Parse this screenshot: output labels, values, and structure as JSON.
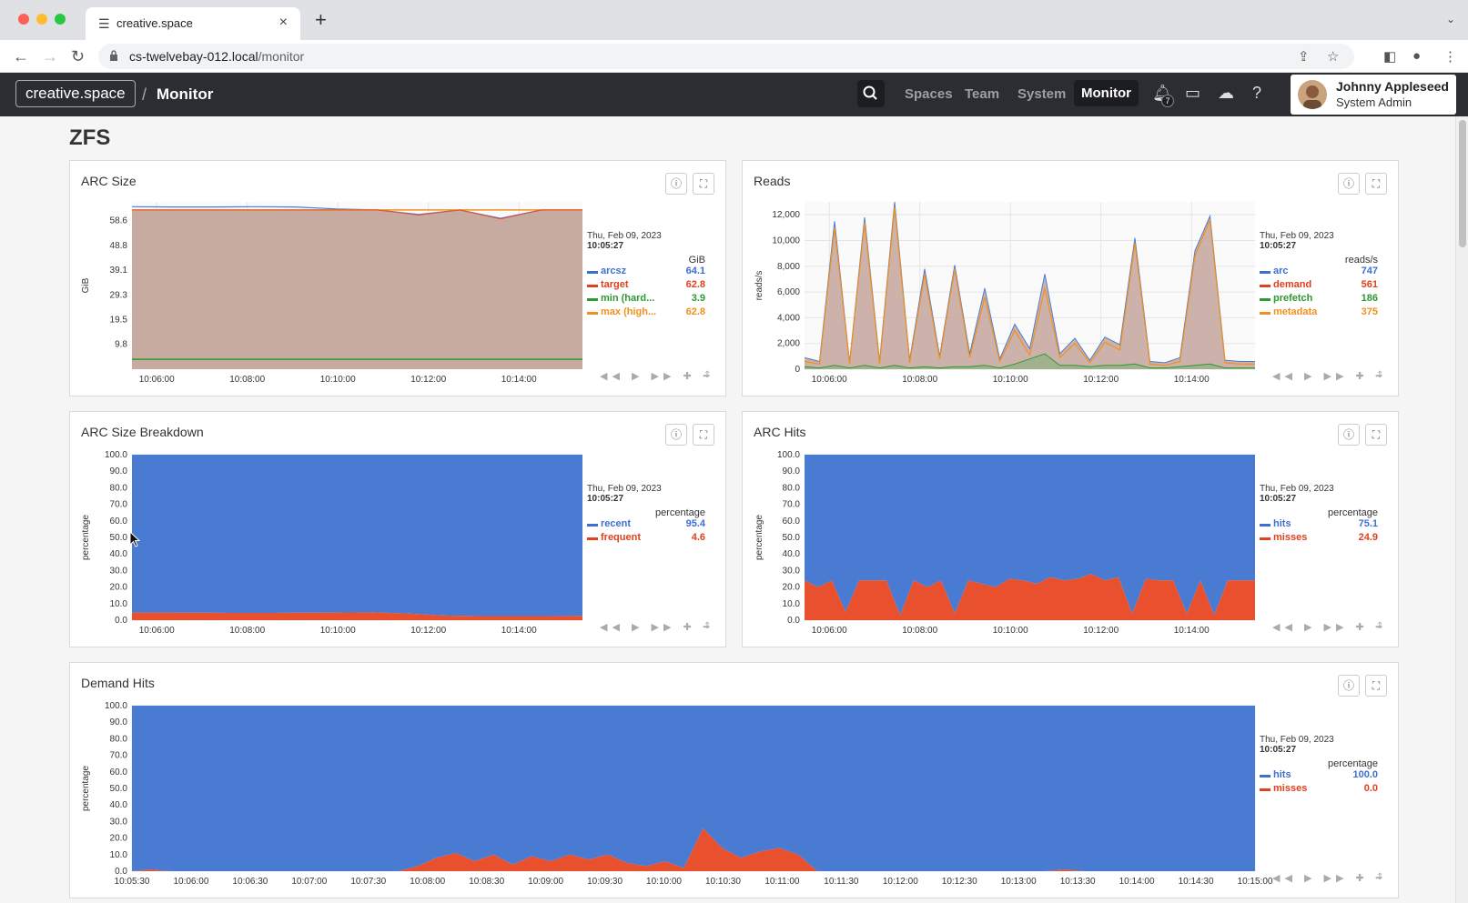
{
  "browser": {
    "tab_title": "creative.space",
    "url_host": "cs-twelvebay-012.local",
    "url_path": "/monitor"
  },
  "app": {
    "brand": "creative.space",
    "breadcrumb": "Monitor",
    "nav": [
      "Spaces",
      "Team",
      "System",
      "Monitor"
    ],
    "active_nav": "Monitor",
    "notification_count": "7",
    "user_name": "Johnny Appleseed",
    "user_role": "System Admin"
  },
  "section_title": "ZFS",
  "colors": {
    "blue": "#4a7bd3",
    "red": "#e8502e",
    "green": "#2b9a2f",
    "orange": "#f0901e",
    "arc_fill": "#c4a69c"
  },
  "panels": {
    "arc_size": {
      "title": "ARC Size",
      "legend_date": "Thu, Feb 09, 2023",
      "legend_time": "10:05:27",
      "unit": "GiB",
      "rows": [
        {
          "name": "arcsz",
          "value": "64.1",
          "color": "#3d6fd0"
        },
        {
          "name": "target",
          "value": "62.8",
          "color": "#e0401e"
        },
        {
          "name": "min (hard...",
          "value": "3.9",
          "color": "#2b9a2f"
        },
        {
          "name": "max (high...",
          "value": "62.8",
          "color": "#f0901e"
        }
      ]
    },
    "reads": {
      "title": "Reads",
      "legend_date": "Thu, Feb 09, 2023",
      "legend_time": "10:05:27",
      "unit": "reads/s",
      "rows": [
        {
          "name": "arc",
          "value": "747",
          "color": "#3d6fd0"
        },
        {
          "name": "demand",
          "value": "561",
          "color": "#e0401e"
        },
        {
          "name": "prefetch",
          "value": "186",
          "color": "#2b9a2f"
        },
        {
          "name": "metadata",
          "value": "375",
          "color": "#f0901e"
        }
      ]
    },
    "arc_breakdown": {
      "title": "ARC Size Breakdown",
      "legend_date": "Thu, Feb 09, 2023",
      "legend_time": "10:05:27",
      "unit": "percentage",
      "rows": [
        {
          "name": "recent",
          "value": "95.4",
          "color": "#3d6fd0"
        },
        {
          "name": "frequent",
          "value": "4.6",
          "color": "#e0401e"
        }
      ]
    },
    "arc_hits": {
      "title": "ARC Hits",
      "legend_date": "Thu, Feb 09, 2023",
      "legend_time": "10:05:27",
      "unit": "percentage",
      "rows": [
        {
          "name": "hits",
          "value": "75.1",
          "color": "#3d6fd0"
        },
        {
          "name": "misses",
          "value": "24.9",
          "color": "#e0401e"
        }
      ]
    },
    "demand_hits": {
      "title": "Demand Hits",
      "legend_date": "Thu, Feb 09, 2023",
      "legend_time": "10:05:27",
      "unit": "percentage",
      "rows": [
        {
          "name": "hits",
          "value": "100.0",
          "color": "#3d6fd0"
        },
        {
          "name": "misses",
          "value": "0.0",
          "color": "#e0401e"
        }
      ]
    }
  },
  "chart_data": [
    {
      "type": "area",
      "title": "ARC Size",
      "ylabel": "GiB",
      "y_ticks": [
        "9.8",
        "19.5",
        "29.3",
        "39.1",
        "48.8",
        "58.6"
      ],
      "ylim": [
        0,
        66
      ],
      "x_ticks": [
        "10:06:00",
        "10:08:00",
        "10:10:00",
        "10:12:00",
        "10:14:00"
      ],
      "series": [
        {
          "name": "arcsz",
          "values": [
            64.1,
            64.0,
            64.0,
            64.1,
            64.0,
            63.2,
            62.8,
            61.0,
            62.8,
            59.5,
            62.8,
            62.8
          ]
        },
        {
          "name": "target",
          "values": [
            62.8,
            62.8,
            62.8,
            62.8,
            62.8,
            62.8,
            62.8,
            60.8,
            62.8,
            59.3,
            62.8,
            62.8
          ]
        },
        {
          "name": "min (hard...",
          "values": [
            3.9,
            3.9,
            3.9,
            3.9,
            3.9,
            3.9,
            3.9,
            3.9,
            3.9,
            3.9,
            3.9,
            3.9
          ]
        },
        {
          "name": "max (high...",
          "values": [
            62.8,
            62.8,
            62.8,
            62.8,
            62.8,
            62.8,
            62.8,
            62.8,
            62.8,
            62.8,
            62.8,
            62.8
          ]
        }
      ]
    },
    {
      "type": "area",
      "title": "Reads",
      "ylabel": "reads/s",
      "y_ticks": [
        "0",
        "2,000",
        "4,000",
        "6,000",
        "8,000",
        "10,000",
        "12,000"
      ],
      "ylim": [
        0,
        13000
      ],
      "x_ticks": [
        "10:06:00",
        "10:08:00",
        "10:10:00",
        "10:12:00",
        "10:14:00"
      ],
      "series": [
        {
          "name": "arc",
          "values": [
            900,
            600,
            11500,
            500,
            11800,
            600,
            13000,
            700,
            7800,
            1000,
            8100,
            1200,
            6300,
            800,
            3500,
            1600,
            7400,
            1200,
            2400,
            700,
            2500,
            1900,
            10200,
            600,
            500,
            900,
            9200,
            11900,
            700,
            600,
            600
          ]
        },
        {
          "name": "demand",
          "values": [
            600,
            400,
            11000,
            400,
            11400,
            400,
            12600,
            500,
            7400,
            800,
            7800,
            900,
            5600,
            600,
            3000,
            1100,
            6300,
            900,
            2000,
            500,
            2100,
            1500,
            9800,
            400,
            300,
            600,
            8800,
            11600,
            500,
            400,
            400
          ]
        },
        {
          "name": "prefetch",
          "values": [
            200,
            100,
            300,
            100,
            300,
            100,
            300,
            100,
            200,
            100,
            200,
            200,
            300,
            100,
            400,
            800,
            1200,
            300,
            300,
            200,
            300,
            300,
            400,
            100,
            100,
            200,
            300,
            400,
            100,
            100,
            100
          ]
        }
      ]
    },
    {
      "type": "area",
      "title": "ARC Size Breakdown",
      "ylabel": "percentage",
      "y_ticks": [
        "0.0",
        "10.0",
        "20.0",
        "30.0",
        "40.0",
        "50.0",
        "60.0",
        "70.0",
        "80.0",
        "90.0",
        "100.0"
      ],
      "ylim": [
        0,
        100
      ],
      "x_ticks": [
        "10:06:00",
        "10:08:00",
        "10:10:00",
        "10:12:00",
        "10:14:00"
      ],
      "series": [
        {
          "name": "frequent",
          "values": [
            4.6,
            4.6,
            4.5,
            4.4,
            4.4,
            4.5,
            4.6,
            4.7,
            4.0,
            2.8,
            2.5,
            2.5,
            2.5,
            2.6
          ]
        },
        {
          "name": "recent",
          "values": [
            95.4,
            95.4,
            95.5,
            95.6,
            95.6,
            95.5,
            95.4,
            95.3,
            96.0,
            97.2,
            97.5,
            97.5,
            97.5,
            97.4
          ]
        }
      ]
    },
    {
      "type": "area",
      "title": "ARC Hits",
      "ylabel": "percentage",
      "y_ticks": [
        "0.0",
        "10.0",
        "20.0",
        "30.0",
        "40.0",
        "50.0",
        "60.0",
        "70.0",
        "80.0",
        "90.0",
        "100.0"
      ],
      "ylim": [
        0,
        100
      ],
      "x_ticks": [
        "10:06:00",
        "10:08:00",
        "10:10:00",
        "10:12:00",
        "10:14:00"
      ],
      "series": [
        {
          "name": "misses",
          "values": [
            24,
            20,
            24,
            5,
            24,
            24,
            24,
            3,
            24,
            20,
            24,
            4,
            24,
            22,
            20,
            25,
            24,
            22,
            26,
            24,
            25,
            28,
            24,
            26,
            4,
            25,
            24,
            24,
            4,
            24,
            3,
            24,
            24,
            24
          ]
        },
        {
          "name": "hits",
          "values": [
            76,
            80,
            76,
            95,
            76,
            76,
            76,
            97,
            76,
            80,
            76,
            96,
            76,
            78,
            80,
            75,
            76,
            78,
            74,
            76,
            75,
            72,
            76,
            74,
            96,
            75,
            76,
            76,
            96,
            76,
            97,
            76,
            76,
            76
          ]
        }
      ]
    },
    {
      "type": "area",
      "title": "Demand Hits",
      "ylabel": "percentage",
      "y_ticks": [
        "0.0",
        "10.0",
        "20.0",
        "30.0",
        "40.0",
        "50.0",
        "60.0",
        "70.0",
        "80.0",
        "90.0",
        "100.0"
      ],
      "ylim": [
        0,
        100
      ],
      "x_ticks": [
        "10:05:30",
        "10:06:00",
        "10:06:30",
        "10:07:00",
        "10:07:30",
        "10:08:00",
        "10:08:30",
        "10:09:00",
        "10:09:30",
        "10:10:00",
        "10:10:30",
        "10:11:00",
        "10:11:30",
        "10:12:00",
        "10:12:30",
        "10:13:00",
        "10:13:30",
        "10:14:00",
        "10:14:30",
        "10:15:00"
      ],
      "series": [
        {
          "name": "misses",
          "values": [
            0,
            1,
            0,
            0,
            0,
            0,
            0,
            0,
            0,
            0,
            0,
            0,
            0,
            0,
            0,
            3,
            8,
            11,
            6,
            10,
            4,
            9,
            6,
            10,
            7,
            10,
            5,
            3,
            6,
            2,
            26,
            14,
            8,
            12,
            14,
            10,
            0,
            0,
            0,
            0,
            0,
            0,
            0,
            0,
            0,
            0,
            0,
            0,
            0,
            1,
            0,
            0,
            0,
            0,
            0,
            0,
            0,
            0,
            0,
            0
          ]
        },
        {
          "name": "hits",
          "values": [
            100,
            99,
            100,
            100,
            100,
            100,
            100,
            100,
            100,
            100,
            100,
            100,
            100,
            100,
            100,
            97,
            92,
            89,
            94,
            90,
            96,
            91,
            94,
            90,
            93,
            90,
            95,
            97,
            94,
            98,
            74,
            86,
            92,
            88,
            86,
            90,
            100,
            100,
            100,
            100,
            100,
            100,
            100,
            100,
            100,
            100,
            100,
            100,
            100,
            99,
            100,
            100,
            100,
            100,
            100,
            100,
            100,
            100,
            100,
            100
          ]
        }
      ]
    }
  ]
}
